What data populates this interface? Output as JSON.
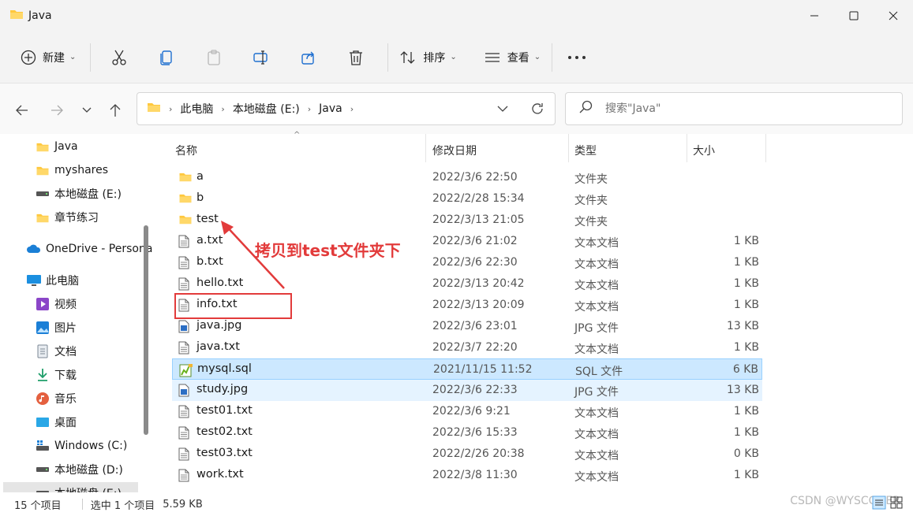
{
  "window": {
    "title": "Java"
  },
  "toolbar": {
    "new_label": "新建",
    "sort_label": "排序",
    "view_label": "查看"
  },
  "address": {
    "crumbs": [
      "此电脑",
      "本地磁盘 (E:)",
      "Java"
    ]
  },
  "search": {
    "placeholder": "搜索\"Java\""
  },
  "sidebar": {
    "items": [
      {
        "label": "Java",
        "icon": "folder-icon"
      },
      {
        "label": "myshares",
        "icon": "folder-icon"
      },
      {
        "label": "本地磁盘 (E:)",
        "icon": "drive-icon"
      },
      {
        "label": "章节练习",
        "icon": "folder-icon"
      },
      {
        "label": "OneDrive - Personal",
        "icon": "cloud-icon"
      },
      {
        "label": "此电脑",
        "icon": "computer-icon"
      },
      {
        "label": "视频",
        "icon": "video-icon"
      },
      {
        "label": "图片",
        "icon": "picture-icon"
      },
      {
        "label": "文档",
        "icon": "document-icon"
      },
      {
        "label": "下载",
        "icon": "download-icon"
      },
      {
        "label": "音乐",
        "icon": "music-icon"
      },
      {
        "label": "桌面",
        "icon": "desktop-icon"
      },
      {
        "label": "Windows (C:)",
        "icon": "windows-drive-icon"
      },
      {
        "label": "本地磁盘 (D:)",
        "icon": "drive-icon"
      },
      {
        "label": "本地磁盘 (E:)",
        "icon": "drive-icon"
      }
    ]
  },
  "columns": {
    "name": "名称",
    "date": "修改日期",
    "type": "类型",
    "size": "大小"
  },
  "files": [
    {
      "name": "a",
      "date": "2022/3/6 22:50",
      "type": "文件夹",
      "size": "",
      "kind": "folder"
    },
    {
      "name": "b",
      "date": "2022/2/28 15:34",
      "type": "文件夹",
      "size": "",
      "kind": "folder"
    },
    {
      "name": "test",
      "date": "2022/3/13 21:05",
      "type": "文件夹",
      "size": "",
      "kind": "folder"
    },
    {
      "name": "a.txt",
      "date": "2022/3/6 21:02",
      "type": "文本文档",
      "size": "1 KB",
      "kind": "txt"
    },
    {
      "name": "b.txt",
      "date": "2022/3/6 22:30",
      "type": "文本文档",
      "size": "1 KB",
      "kind": "txt"
    },
    {
      "name": "hello.txt",
      "date": "2022/3/13 20:42",
      "type": "文本文档",
      "size": "1 KB",
      "kind": "txt"
    },
    {
      "name": "info.txt",
      "date": "2022/3/13 20:09",
      "type": "文本文档",
      "size": "1 KB",
      "kind": "txt"
    },
    {
      "name": "java.jpg",
      "date": "2022/3/6 23:01",
      "type": "JPG 文件",
      "size": "13 KB",
      "kind": "jpg"
    },
    {
      "name": "java.txt",
      "date": "2022/3/7 22:20",
      "type": "文本文档",
      "size": "1 KB",
      "kind": "txt"
    },
    {
      "name": "mysql.sql",
      "date": "2021/11/15 11:52",
      "type": "SQL 文件",
      "size": "6 KB",
      "kind": "sql"
    },
    {
      "name": "study.jpg",
      "date": "2022/3/6 22:33",
      "type": "JPG 文件",
      "size": "13 KB",
      "kind": "jpg"
    },
    {
      "name": "test01.txt",
      "date": "2022/3/6 9:21",
      "type": "文本文档",
      "size": "1 KB",
      "kind": "txt"
    },
    {
      "name": "test02.txt",
      "date": "2022/3/6 15:33",
      "type": "文本文档",
      "size": "1 KB",
      "kind": "txt"
    },
    {
      "name": "test03.txt",
      "date": "2022/2/26 20:38",
      "type": "文本文档",
      "size": "0 KB",
      "kind": "txt"
    },
    {
      "name": "work.txt",
      "date": "2022/3/8 11:30",
      "type": "文本文档",
      "size": "1 KB",
      "kind": "txt"
    }
  ],
  "annotation": {
    "text": "拷贝到test文件夹下"
  },
  "status": {
    "count": "15 个项目",
    "selected": "选中 1 个项目",
    "size": "5.59 KB"
  },
  "watermark": "CSDN @WYSCODER",
  "colors": {
    "accent": "#0067c0",
    "selected_bg": "#cce8ff",
    "annotation": "#e23b3b",
    "folder": "#ffc83d"
  }
}
